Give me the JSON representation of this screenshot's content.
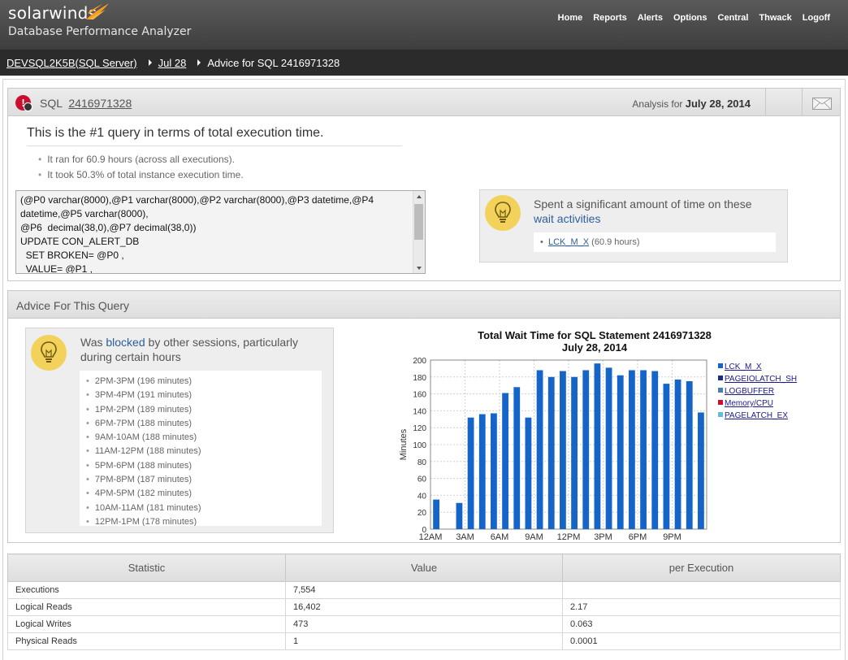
{
  "header": {
    "brand": "solarwinds",
    "product": "Database Performance Analyzer",
    "brand_color": "#f99d1c",
    "nav": [
      "Home",
      "Reports",
      "Alerts",
      "Options",
      "Central",
      "Thwack",
      "Logoff"
    ]
  },
  "breadcrumbs": {
    "server": "DEVSQL2K5B(SQL Server)",
    "date": "Jul 28",
    "current": "Advice for SQL 2416971328"
  },
  "sql_panel": {
    "label": "SQL",
    "sql_id": "2416971328",
    "analysis_label": "Analysis for",
    "analysis_date": "July 28, 2014",
    "headline": "This is the #1 query in terms of total execution time.",
    "bullets": [
      "It ran for 60.9 hours (across all executions).",
      "It took 50.3% of total instance execution time."
    ],
    "code": [
      "(@P0 varchar(8000),@P1 varchar(8000),@P2 varchar(8000),@P3 datetime,@P4",
      "datetime,@P5 varchar(8000),",
      "@P6  decimal(38,0),@P7 decimal(38,0))",
      "UPDATE CON_ALERT_DB",
      "  SET BROKEN= @P0 ,",
      "  VALUE= @P1 ,"
    ],
    "wait_tip": {
      "text": "Spent a significant amount of time on these",
      "link": "wait activities",
      "item_name": "LCK_M_X",
      "item_value": "(60.9 hours)"
    }
  },
  "advice_panel": {
    "title": "Advice For This Query",
    "tip_prefix": "Was",
    "tip_link": "blocked",
    "tip_suffix": "by other sessions, particularly during certain hours",
    "hours": [
      "2PM-3PM (196 minutes)",
      "3PM-4PM (191 minutes)",
      "1PM-2PM (189 minutes)",
      "6PM-7PM (188 minutes)",
      "9AM-10AM (188 minutes)",
      "11AM-12PM (188 minutes)",
      "5PM-6PM (188 minutes)",
      "7PM-8PM (187 minutes)",
      "4PM-5PM (182 minutes)",
      "10AM-11AM (181 minutes)",
      "12PM-1PM (178 minutes)"
    ]
  },
  "chart_data": {
    "type": "bar",
    "title": "Total Wait Time for SQL Statement 2416971328",
    "subtitle": "July 28, 2014",
    "ylabel": "Minutes",
    "xlabel": "",
    "ylim": [
      0,
      200
    ],
    "yticks": [
      0,
      20,
      40,
      60,
      80,
      100,
      120,
      140,
      160,
      180,
      200
    ],
    "xtick_labels": [
      "12AM",
      "3AM",
      "6AM",
      "9AM",
      "12PM",
      "3PM",
      "6PM",
      "9PM"
    ],
    "categories": [
      "0",
      "1",
      "2",
      "3",
      "4",
      "5",
      "6",
      "7",
      "8",
      "9",
      "10",
      "11",
      "12",
      "13",
      "14",
      "15",
      "16",
      "17",
      "18",
      "19",
      "20",
      "21",
      "22",
      "23"
    ],
    "series": [
      {
        "name": "LCK_M_X",
        "color": "#1565c8",
        "values": [
          35,
          0,
          31,
          132,
          136,
          137,
          161,
          168,
          132,
          188,
          180,
          187,
          180,
          188,
          196,
          191,
          182,
          188,
          188,
          187,
          172,
          177,
          175,
          138
        ]
      }
    ],
    "legend": [
      {
        "name": "LCK_M_X",
        "color": "#1565c8"
      },
      {
        "name": "PAGEIOLATCH_SH",
        "color": "#1c2f7a"
      },
      {
        "name": "LOGBUFFER",
        "color": "#4a7fa8"
      },
      {
        "name": "Memory/CPU",
        "color": "#c8102e"
      },
      {
        "name": "PAGELATCH_EX",
        "color": "#5bc0d6"
      }
    ],
    "legend_position": "right",
    "grid": true
  },
  "stats": {
    "headers": [
      "Statistic",
      "Value",
      "per Execution"
    ],
    "rows": [
      [
        "Executions",
        "7,554",
        ""
      ],
      [
        "Logical Reads",
        "16,402",
        "2.17"
      ],
      [
        "Logical Writes",
        "473",
        "0.063"
      ],
      [
        "Physical Reads",
        "1",
        "0.0001"
      ]
    ]
  }
}
